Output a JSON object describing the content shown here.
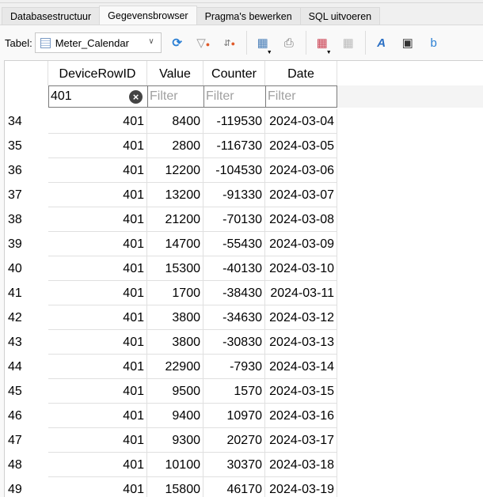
{
  "tabs": [
    "Databasestructuur",
    "Gegevensbrowser",
    "Pragma's bewerken",
    "SQL uitvoeren"
  ],
  "active_tab": 1,
  "toolbar": {
    "table_label": "Tabel:",
    "table_value": "Meter_Calendar"
  },
  "columns": [
    "DeviceRowID",
    "Value",
    "Counter",
    "Date"
  ],
  "filters": {
    "DeviceRowID": "401",
    "placeholder": "Filter"
  },
  "rows": [
    [
      "34",
      "401",
      "8400",
      "-119530",
      "2024-03-04"
    ],
    [
      "35",
      "401",
      "2800",
      "-116730",
      "2024-03-05"
    ],
    [
      "36",
      "401",
      "12200",
      "-104530",
      "2024-03-06"
    ],
    [
      "37",
      "401",
      "13200",
      "-91330",
      "2024-03-07"
    ],
    [
      "38",
      "401",
      "21200",
      "-70130",
      "2024-03-08"
    ],
    [
      "39",
      "401",
      "14700",
      "-55430",
      "2024-03-09"
    ],
    [
      "40",
      "401",
      "15300",
      "-40130",
      "2024-03-10"
    ],
    [
      "41",
      "401",
      "1700",
      "-38430",
      "2024-03-11"
    ],
    [
      "42",
      "401",
      "3800",
      "-34630",
      "2024-03-12"
    ],
    [
      "43",
      "401",
      "3800",
      "-30830",
      "2024-03-13"
    ],
    [
      "44",
      "401",
      "22900",
      "-7930",
      "2024-03-14"
    ],
    [
      "45",
      "401",
      "9500",
      "1570",
      "2024-03-15"
    ],
    [
      "46",
      "401",
      "9400",
      "10970",
      "2024-03-16"
    ],
    [
      "47",
      "401",
      "9300",
      "20270",
      "2024-03-17"
    ],
    [
      "48",
      "401",
      "10100",
      "30370",
      "2024-03-18"
    ],
    [
      "49",
      "401",
      "15800",
      "46170",
      "2024-03-19"
    ]
  ]
}
